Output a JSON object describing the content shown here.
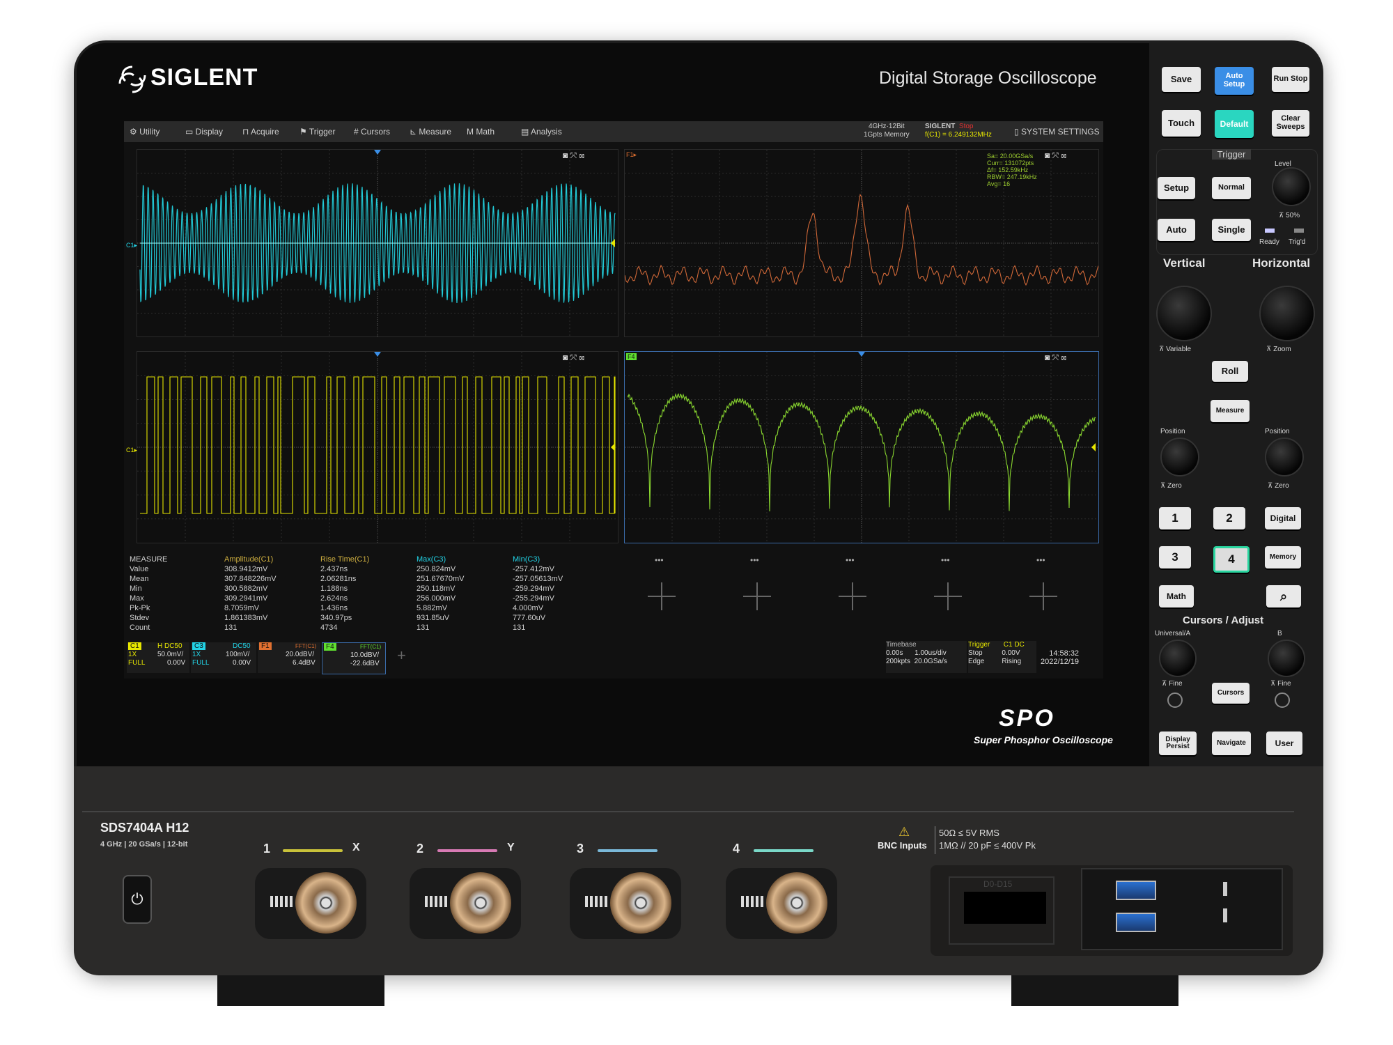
{
  "brand": "SIGLENT",
  "device_title": "Digital Storage Oscilloscope",
  "menu": [
    "Utility",
    "Display",
    "Acquire",
    "Trigger",
    "Cursors",
    "Measure",
    "Math",
    "Analysis"
  ],
  "status": {
    "spec_line1": "4GHz·12Bit",
    "spec_line2": "1Gpts Memory",
    "brand_small": "SIGLENT",
    "run_state": "Stop",
    "freq": "f(C1) = 6.249132MHz",
    "system_settings": "SYSTEM SETTINGS"
  },
  "fft_info": [
    "Sa= 20.00GSa/s",
    "Curr= 131072pts",
    "Δf= 152.59kHz",
    "RBW= 247.19kHz",
    "Avg= 16"
  ],
  "pane_labels": {
    "c1_top": "C1▸",
    "c1_bottom": "C1▸",
    "f1": "F1▸",
    "f4": "F4"
  },
  "measure": {
    "headers": [
      "MEASURE",
      "Amplitude(C1)",
      "Rise Time(C1)",
      "Max(C3)",
      "Min(C3)"
    ],
    "rows": [
      [
        "Value",
        "308.9412mV",
        "2.437ns",
        "250.824mV",
        "-257.412mV"
      ],
      [
        "Mean",
        "307.848226mV",
        "2.06281ns",
        "251.67670mV",
        "-257.05613mV"
      ],
      [
        "Min",
        "300.5882mV",
        "1.188ns",
        "250.118mV",
        "-259.294mV"
      ],
      [
        "Max",
        "309.2941mV",
        "2.624ns",
        "256.000mV",
        "-255.294mV"
      ],
      [
        "Pk-Pk",
        "8.7059mV",
        "1.436ns",
        "5.882mV",
        "4.000mV"
      ],
      [
        "Stdev",
        "1.861383mV",
        "340.97ps",
        "931.85uV",
        "777.60uV"
      ],
      [
        "Count",
        "131",
        "4734",
        "131",
        "131"
      ]
    ]
  },
  "channels": [
    {
      "tag": "C1",
      "flags": "H  DC50",
      "probe": "1X",
      "scale": "50.0mV/",
      "bw": "FULL",
      "offset": "0.00V",
      "color": "#e6e600"
    },
    {
      "tag": "C3",
      "flags": "DC50",
      "probe": "1X",
      "scale": "100mV/",
      "bw": "FULL",
      "offset": "0.00V",
      "color": "#22d3e6"
    },
    {
      "tag": "F1",
      "flags": "FFT(C1)",
      "scale": "20.0dBV/",
      "offset": "6.4dBV",
      "color": "#e07030"
    },
    {
      "tag": "F4",
      "flags": "FFT(C1)",
      "scale": "10.0dBV/",
      "offset": "-22.6dBV",
      "color": "#60e030"
    }
  ],
  "timebase": {
    "label": "Timebase",
    "delay": "0.00s",
    "tdiv": "1.00us/div",
    "pts": "200kpts",
    "sa": "20.0GSa/s"
  },
  "trigger": {
    "label": "Trigger",
    "src": "C1 DC",
    "state": "Stop",
    "level": "0.00V",
    "type": "Edge",
    "slope": "Rising"
  },
  "clock": {
    "time": "14:58:32",
    "date": "2022/12/19"
  },
  "logo_spo": "SPO",
  "spo_text": "Super Phosphor Oscilloscope",
  "buttons": {
    "save": "Save",
    "auto_setup": "Auto Setup",
    "run_stop": "Run Stop",
    "touch": "Touch",
    "default": "Default",
    "clear_sweeps": "Clear Sweeps",
    "trigger_title": "Trigger",
    "setup": "Setup",
    "normal": "Normal",
    "auto": "Auto",
    "single": "Single",
    "level_lbl": "Level",
    "fifty": "50%",
    "ready": "Ready",
    "trigd": "Trig'd",
    "vertical": "Vertical",
    "horizontal": "Horizontal",
    "variable": "Variable",
    "zoom": "Zoom",
    "roll": "Roll",
    "measure": "Measure",
    "position_v": "Position",
    "position_h": "Position",
    "zero_v": "Zero",
    "zero_h": "Zero",
    "ch1": "1",
    "ch2": "2",
    "digital": "Digital",
    "ch3": "3",
    "ch4": "4",
    "memory": "Memory",
    "math": "Math",
    "cursors_adjust": "Cursors / Adjust",
    "universal_a": "Universal/A",
    "b": "B",
    "fine_a": "Fine",
    "fine_b": "Fine",
    "cursors": "Cursors",
    "display_persist": "Display Persist",
    "navigate": "Navigate",
    "user": "User"
  },
  "model": {
    "name": "SDS7404A  H12",
    "spec": "4 GHz | 20 GSa/s | 12-bit"
  },
  "inputs": [
    {
      "num": "1",
      "alt": "X",
      "color": "#c9c23a"
    },
    {
      "num": "2",
      "alt": "Y",
      "color": "#d77ab4"
    },
    {
      "num": "3",
      "alt": "",
      "color": "#7ab8d8"
    },
    {
      "num": "4",
      "alt": "",
      "color": "#7ad8c8"
    }
  ],
  "bnc_warning": {
    "title": "BNC Inputs",
    "line1": "50Ω ≤ 5V RMS",
    "line2": "1MΩ // 20 pF ≤ 400V Pk"
  },
  "io_label": "D0-D15"
}
